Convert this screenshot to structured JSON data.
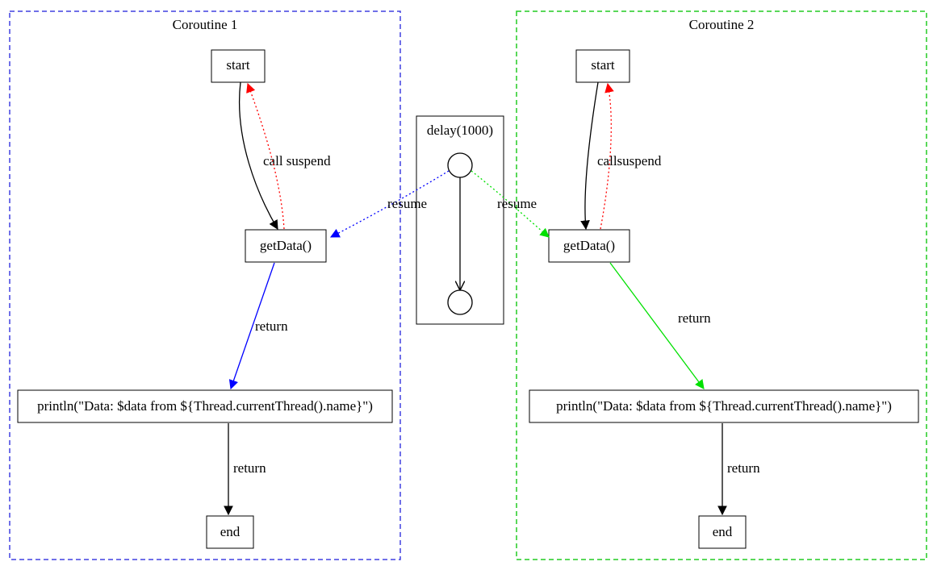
{
  "clusters": {
    "c1": {
      "title": "Coroutine 1"
    },
    "c2": {
      "title": "Coroutine 2"
    }
  },
  "nodes": {
    "c1_start": "start",
    "c1_getData": "getData()",
    "c1_println": "println(\"Data: $data from ${Thread.currentThread().name}\")",
    "c1_end": "end",
    "c2_start": "start",
    "c2_getData": "getData()",
    "c2_println": "println(\"Data: $data from ${Thread.currentThread().name}\")",
    "c2_end": "end",
    "delay": "delay(1000)"
  },
  "edges": {
    "c1_call_suspend": "call suspend",
    "c1_return1": "return",
    "c1_return2": "return",
    "c1_resume": "resume",
    "c2_call_suspend": "callsuspend",
    "c2_return1": "return",
    "c2_return2": "return",
    "c2_resume": "resume"
  },
  "colors": {
    "cluster1_border": "#4040e0",
    "cluster2_border": "#22cc22",
    "edge_blue": "#0000ff",
    "edge_green": "#00e000",
    "edge_red": "#ff0000",
    "edge_black": "#000000"
  },
  "chart_data": {
    "type": "diagram",
    "title": "",
    "clusters": [
      {
        "id": "Coroutine 1",
        "border_color": "#4040e0",
        "nodes": [
          {
            "id": "c1_start",
            "label": "start",
            "shape": "box"
          },
          {
            "id": "c1_getData",
            "label": "getData()",
            "shape": "box"
          },
          {
            "id": "c1_println",
            "label": "println(\"Data: $data from ${Thread.currentThread().name}\")",
            "shape": "box"
          },
          {
            "id": "c1_end",
            "label": "end",
            "shape": "box"
          }
        ]
      },
      {
        "id": "Coroutine 2",
        "border_color": "#22cc22",
        "nodes": [
          {
            "id": "c2_start",
            "label": "start",
            "shape": "box"
          },
          {
            "id": "c2_getData",
            "label": "getData()",
            "shape": "box"
          },
          {
            "id": "c2_println",
            "label": "println(\"Data: $data from ${Thread.currentThread().name}\")",
            "shape": "box"
          },
          {
            "id": "c2_end",
            "label": "end",
            "shape": "box"
          }
        ]
      },
      {
        "id": "delay_cluster",
        "border_color": "#000000",
        "nodes": [
          {
            "id": "delay_label",
            "label": "delay(1000)",
            "shape": "label"
          },
          {
            "id": "delay_top",
            "label": "",
            "shape": "circle"
          },
          {
            "id": "delay_bot",
            "label": "",
            "shape": "circle"
          }
        ]
      }
    ],
    "edges": [
      {
        "from": "c1_start",
        "to": "c1_getData",
        "label": "call suspend",
        "color": "#000000",
        "style": "solid"
      },
      {
        "from": "c1_getData",
        "to": "c1_start",
        "label": "",
        "color": "#ff0000",
        "style": "dotted"
      },
      {
        "from": "c1_getData",
        "to": "c1_println",
        "label": "return",
        "color": "#0000ff",
        "style": "solid"
      },
      {
        "from": "c1_println",
        "to": "c1_end",
        "label": "return",
        "color": "#000000",
        "style": "solid"
      },
      {
        "from": "delay_top",
        "to": "c1_getData",
        "label": "resume",
        "color": "#0000ff",
        "style": "dotted"
      },
      {
        "from": "delay_top",
        "to": "delay_bot",
        "label": "",
        "color": "#000000",
        "style": "solid"
      },
      {
        "from": "delay_top",
        "to": "c2_getData",
        "label": "resume",
        "color": "#00e000",
        "style": "dotted"
      },
      {
        "from": "c2_start",
        "to": "c2_getData",
        "label": "callsuspend",
        "color": "#000000",
        "style": "solid"
      },
      {
        "from": "c2_getData",
        "to": "c2_start",
        "label": "",
        "color": "#ff0000",
        "style": "dotted"
      },
      {
        "from": "c2_getData",
        "to": "c2_println",
        "label": "return",
        "color": "#00e000",
        "style": "solid"
      },
      {
        "from": "c2_println",
        "to": "c2_end",
        "label": "return",
        "color": "#000000",
        "style": "solid"
      }
    ]
  }
}
